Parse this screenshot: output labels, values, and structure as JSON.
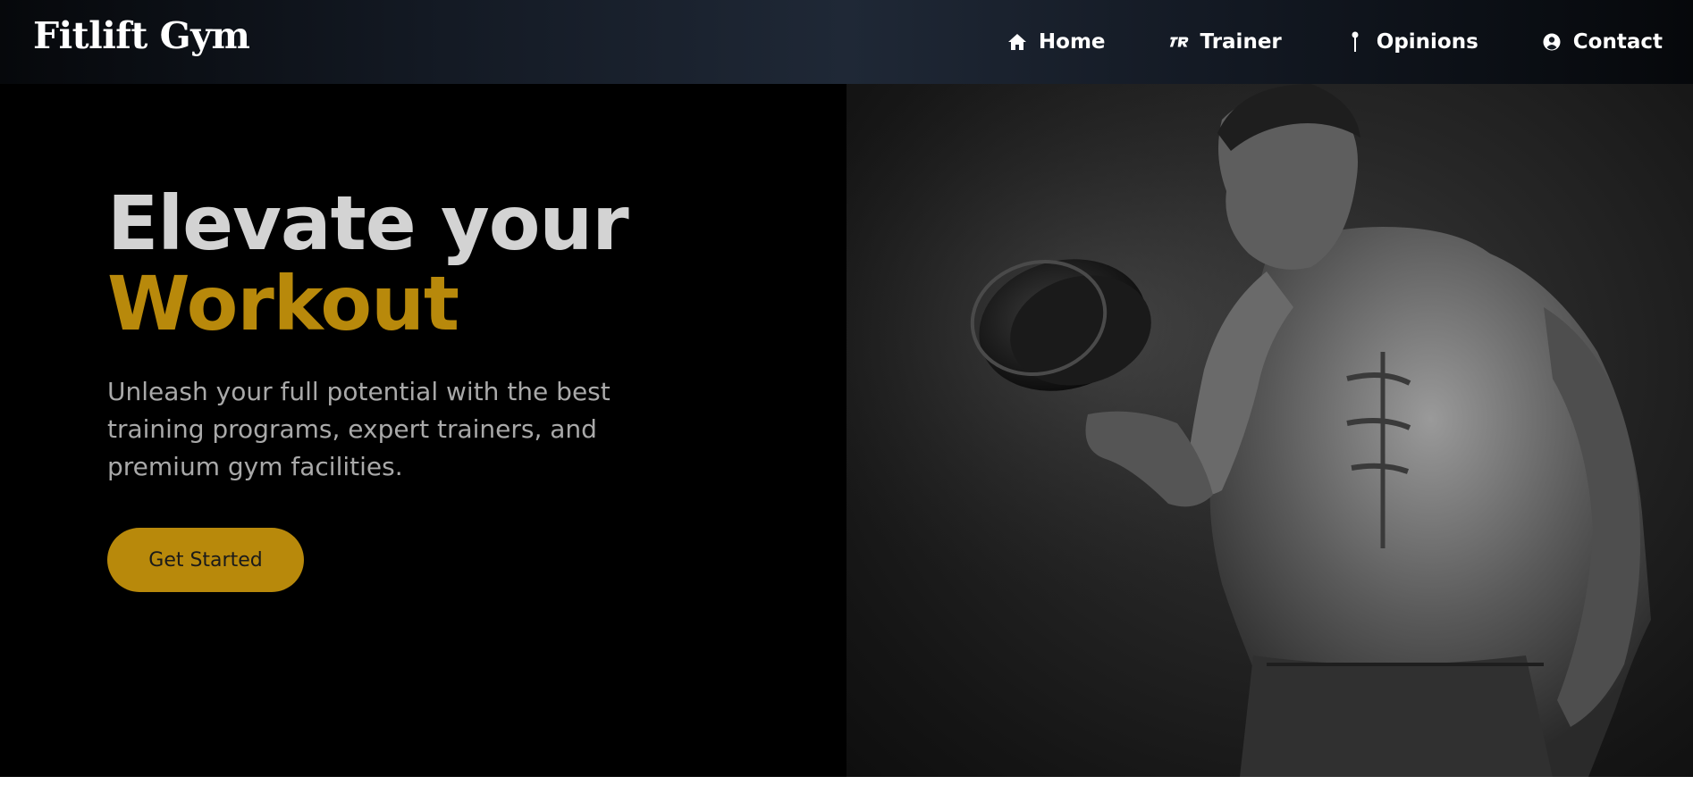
{
  "brand": {
    "name": "Fitlift Gym"
  },
  "nav": {
    "items": [
      {
        "label": "Home",
        "icon": "home-icon"
      },
      {
        "label": "Trainer",
        "icon": "trainer-icon"
      },
      {
        "label": "Opinions",
        "icon": "pin-icon"
      },
      {
        "label": "Contact",
        "icon": "user-circle-icon"
      }
    ]
  },
  "hero": {
    "headline_line1": "Elevate your",
    "headline_line2": "Workout",
    "subtitle": "Unleash your full potential with the best training programs, expert trainers, and premium gym facilities.",
    "cta_label": "Get Started",
    "image": "bodybuilder-with-dumbbell-photo"
  },
  "colors": {
    "accent": "#b8890b",
    "headline": "#d3d3d3",
    "subtitle": "#a9a9a9",
    "background": "#000000"
  }
}
